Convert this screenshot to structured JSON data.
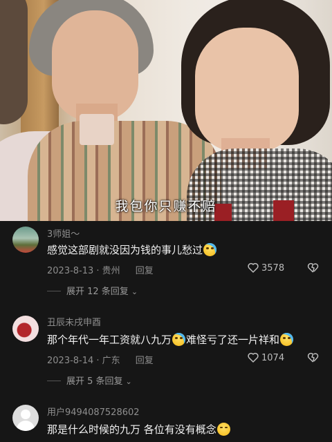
{
  "video": {
    "subtitle": "我包你只赚不赔"
  },
  "comments": [
    {
      "username": "3师姐～",
      "text": "感觉这部剧就没因为钱的事儿愁过",
      "emoji": "laughing-crying-emoji",
      "date_location": "2023-8-13 · 贵州",
      "reply_label": "回复",
      "like_count": "3578",
      "expand_label": "展开 12 条回复"
    },
    {
      "username": "丑辰未戌申酉",
      "text_part1": "那个年代一年工资就八九万",
      "text_part2": "难怪亏了还一片祥和",
      "emoji": "laughing-crying-emoji",
      "date_location": "2023-8-14 · 广东",
      "reply_label": "回复",
      "like_count": "1074",
      "expand_label": "展开 5 条回复"
    },
    {
      "username": "用户9494087528602",
      "text": "那是什么时候的九万 各位有没有概念",
      "emoji": "smile-emoji"
    }
  ],
  "colors": {
    "background": "#161616",
    "username": "#8e8e8e",
    "comment_text": "#f2f2f2"
  }
}
